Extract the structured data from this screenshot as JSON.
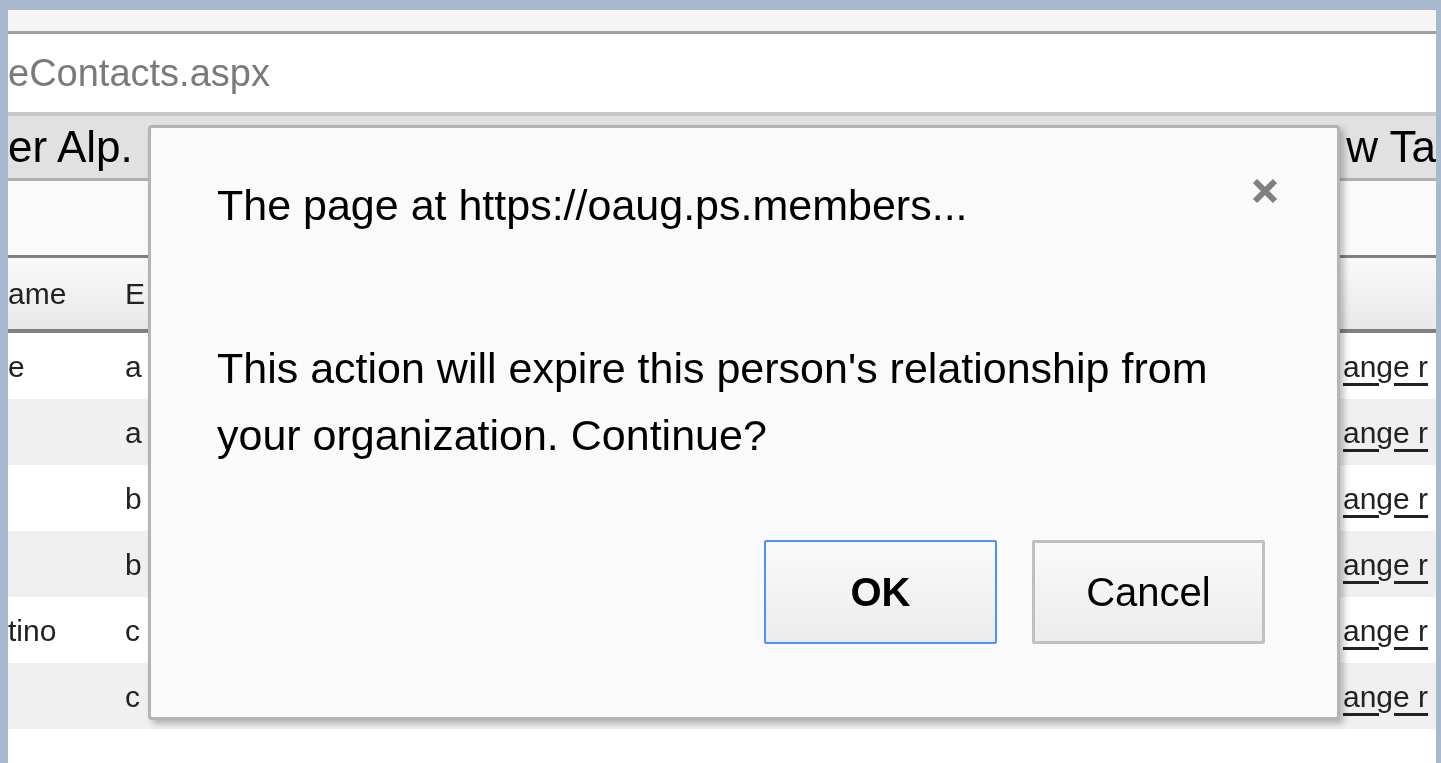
{
  "address_bar": {
    "url_fragment": "eContacts.aspx"
  },
  "page_tabs": [
    {
      "label": "er Alp."
    },
    {
      "label": "w Ta"
    }
  ],
  "table": {
    "columns": [
      "ame",
      "E"
    ],
    "rows": [
      {
        "name": "e",
        "email": "a",
        "link": "ange r"
      },
      {
        "email": "a",
        "link": "ange r"
      },
      {
        "email": "b",
        "link": "ange r"
      },
      {
        "email": "b",
        "link": "ange r"
      },
      {
        "name": "tino",
        "email": "c",
        "link": "ange r"
      },
      {
        "email": "c",
        "link": "ange r"
      },
      {}
    ]
  },
  "dialog": {
    "title": "The page at https://oaug.ps.members...",
    "message": "This action will expire this person's relationship from your organization. Continue?",
    "buttons": [
      {
        "label": "OK",
        "default": true
      },
      {
        "label": "Cancel",
        "default": false
      }
    ]
  }
}
